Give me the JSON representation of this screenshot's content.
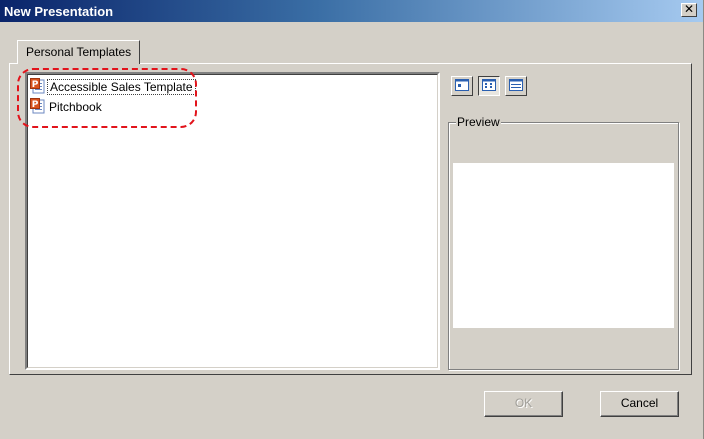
{
  "window": {
    "title": "New Presentation",
    "close_glyph": "✕"
  },
  "tabs": [
    {
      "label": "Personal Templates",
      "active": true
    }
  ],
  "templates": [
    {
      "label": "Accessible Sales Template",
      "icon": "powerpoint-file-icon",
      "selected": true
    },
    {
      "label": "Pitchbook",
      "icon": "powerpoint-file-icon",
      "selected": false
    }
  ],
  "view_buttons": [
    {
      "name": "large-icons-view",
      "pressed": false
    },
    {
      "name": "list-view",
      "pressed": true
    },
    {
      "name": "details-view",
      "pressed": false
    }
  ],
  "preview": {
    "label": "Preview"
  },
  "buttons": {
    "ok": {
      "label": "OK",
      "enabled": false
    },
    "cancel": {
      "label": "Cancel",
      "enabled": true
    }
  },
  "annotation": {
    "color": "#e2131b",
    "style": "dashed-rounded-highlight"
  }
}
